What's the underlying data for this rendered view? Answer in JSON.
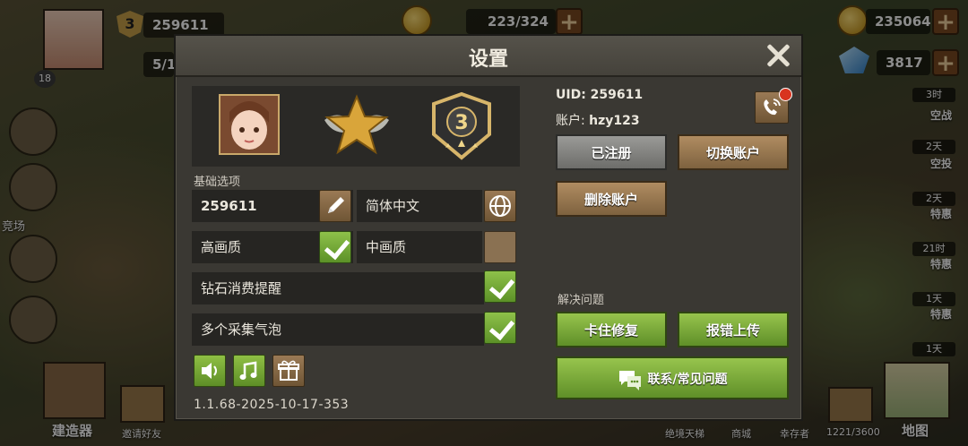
{
  "hud": {
    "player_id": "259611",
    "level": "3",
    "player_level_badge": "18",
    "capacity": "223/324",
    "gold": "235064",
    "gems": "3817",
    "partial_resource": "5/1",
    "bell_count": "0"
  },
  "side": {
    "timers": [
      "3时",
      "2天",
      "2天",
      "21时",
      "1天",
      "1天"
    ],
    "labels": [
      "空战",
      "空投",
      "特惠",
      "特惠",
      "特惠"
    ]
  },
  "bottom": {
    "builder": "建造器",
    "invite": "邀请好友",
    "rename": "绝境天梯",
    "shop": "商城",
    "survivor": "幸存者",
    "storage": "1221/3600",
    "map": "地图",
    "arena": "竞场"
  },
  "dialog": {
    "title": "设置",
    "section_basic": "基础选项",
    "player_name": "259611",
    "language": "简体中文",
    "quality_high": "高画质",
    "quality_medium": "中画质",
    "diamond_reminder": "钻石消费提醒",
    "multi_bubble": "多个采集气泡",
    "version": "1.1.68-2025-10-17-353",
    "uid_text": "UID: 259611",
    "account_label": "账户:",
    "account_value": "hzy123",
    "registered": "已注册",
    "switch_account": "切换账户",
    "delete_account": "删除账户",
    "section_issue": "解决问题",
    "stuck_fix": "卡住修复",
    "report_upload": "报错上传",
    "contact_faq": "联系/常见问题"
  },
  "toggles": {
    "quality_high": true,
    "quality_medium": false,
    "diamond_reminder": true,
    "multi_bubble": true
  },
  "rank_level": "3",
  "colors": {
    "accent_green": "#7fb23a",
    "wood": "#8a6b47",
    "gray_button": "#8a8a87"
  }
}
